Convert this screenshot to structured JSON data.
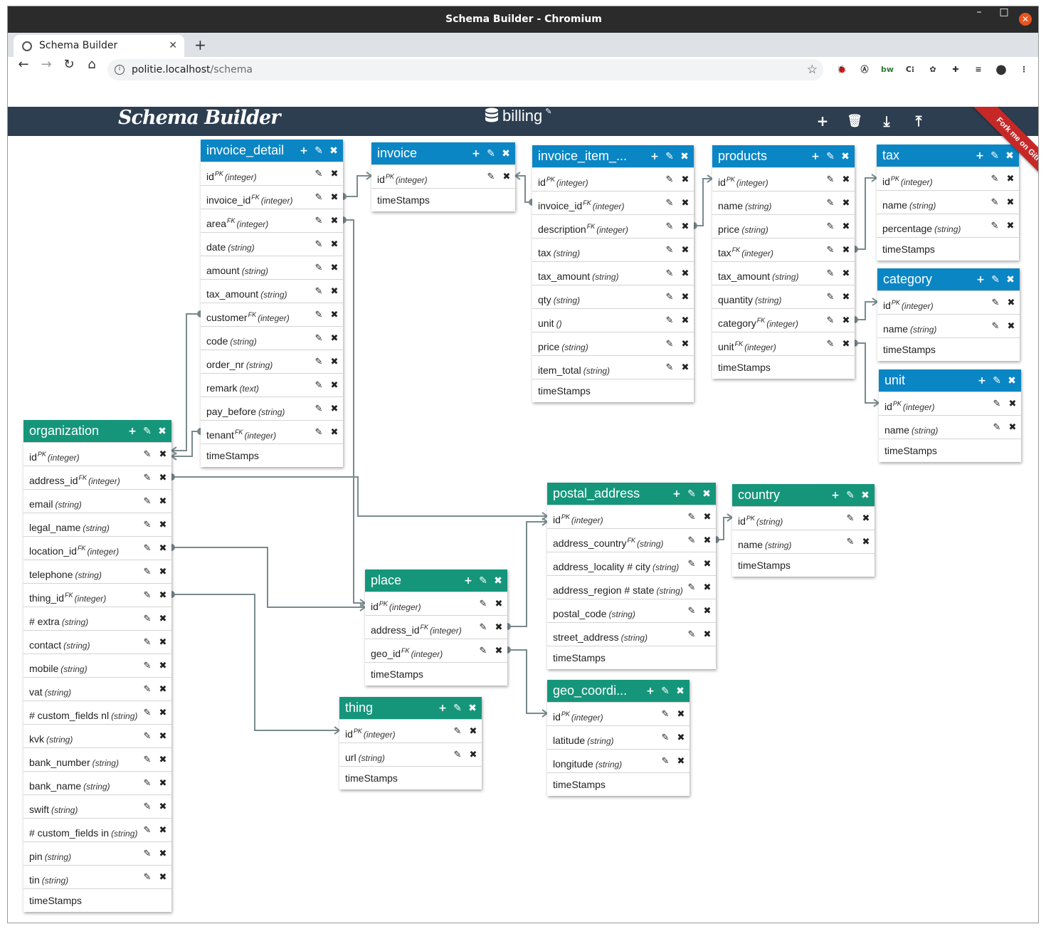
{
  "window": {
    "title": "Schema Builder - Chromium",
    "min": "–",
    "max": "□",
    "close": "✕"
  },
  "tab": {
    "title": "Schema Builder",
    "close": "✕",
    "newtab": "+"
  },
  "nav": {
    "back": "←",
    "forward": "→",
    "reload": "↻",
    "home": "⌂"
  },
  "address": {
    "host": "politie.localhost",
    "path": "/schema",
    "star": "☆"
  },
  "extensions": [
    "🐞",
    "Ⓐ",
    "bw",
    "C⁝",
    "✿",
    "✚",
    "≡",
    "●",
    "⋮"
  ],
  "app": {
    "brand": "Schema Builder",
    "database": "billing",
    "edit_icon": "✎",
    "actions": {
      "add": "+",
      "delete": "🗑",
      "download": "⤓",
      "upload": "⤒"
    },
    "ribbon": "Fork me on GitHub"
  },
  "icons": {
    "add": "+",
    "edit": "✎",
    "remove": "✖"
  },
  "colors": {
    "header": "#2c3e50",
    "blue": "#0b86c5",
    "green": "#15967b",
    "link": "#7a8a8d",
    "ribbon": "#c62828"
  },
  "tables": {
    "invoice_detail": {
      "name": "invoice_detail",
      "columns": [
        {
          "name": "id",
          "key": "PK",
          "type": "(integer)"
        },
        {
          "name": "invoice_id",
          "key": "FK",
          "type": "(integer)"
        },
        {
          "name": "area",
          "key": "FK",
          "type": "(integer)"
        },
        {
          "name": "date",
          "key": "",
          "type": "(string)"
        },
        {
          "name": "amount",
          "key": "",
          "type": "(string)"
        },
        {
          "name": "tax_amount",
          "key": "",
          "type": "(string)"
        },
        {
          "name": "customer",
          "key": "FK",
          "type": "(integer)"
        },
        {
          "name": "code",
          "key": "",
          "type": "(string)"
        },
        {
          "name": "order_nr",
          "key": "",
          "type": "(string)"
        },
        {
          "name": "remark",
          "key": "",
          "type": "(text)"
        },
        {
          "name": "pay_before",
          "key": "",
          "type": "(string)"
        },
        {
          "name": "tenant",
          "key": "FK",
          "type": "(integer)"
        }
      ],
      "footer": "timeStamps"
    },
    "invoice": {
      "name": "invoice",
      "columns": [
        {
          "name": "id",
          "key": "PK",
          "type": "(integer)"
        }
      ],
      "footer": "timeStamps"
    },
    "invoice_item": {
      "name": "invoice_item_...",
      "columns": [
        {
          "name": "id",
          "key": "PK",
          "type": "(integer)"
        },
        {
          "name": "invoice_id",
          "key": "FK",
          "type": "(integer)"
        },
        {
          "name": "description",
          "key": "FK",
          "type": "(integer)"
        },
        {
          "name": "tax",
          "key": "",
          "type": "(string)"
        },
        {
          "name": "tax_amount",
          "key": "",
          "type": "(string)"
        },
        {
          "name": "qty",
          "key": "",
          "type": "(string)"
        },
        {
          "name": "unit",
          "key": "",
          "type": "()"
        },
        {
          "name": "price",
          "key": "",
          "type": "(string)"
        },
        {
          "name": "item_total",
          "key": "",
          "type": "(string)"
        }
      ],
      "footer": "timeStamps"
    },
    "products": {
      "name": "products",
      "columns": [
        {
          "name": "id",
          "key": "PK",
          "type": "(integer)"
        },
        {
          "name": "name",
          "key": "",
          "type": "(string)"
        },
        {
          "name": "price",
          "key": "",
          "type": "(string)"
        },
        {
          "name": "tax",
          "key": "FK",
          "type": "(integer)"
        },
        {
          "name": "tax_amount",
          "key": "",
          "type": "(string)"
        },
        {
          "name": "quantity",
          "key": "",
          "type": "(string)"
        },
        {
          "name": "category",
          "key": "FK",
          "type": "(integer)"
        },
        {
          "name": "unit",
          "key": "FK",
          "type": "(integer)"
        }
      ],
      "footer": "timeStamps"
    },
    "tax": {
      "name": "tax",
      "columns": [
        {
          "name": "id",
          "key": "PK",
          "type": "(integer)"
        },
        {
          "name": "name",
          "key": "",
          "type": "(string)"
        },
        {
          "name": "percentage",
          "key": "",
          "type": "(string)"
        }
      ],
      "footer": "timeStamps"
    },
    "category": {
      "name": "category",
      "columns": [
        {
          "name": "id",
          "key": "PK",
          "type": "(integer)"
        },
        {
          "name": "name",
          "key": "",
          "type": "(string)"
        }
      ],
      "footer": "timeStamps"
    },
    "unit": {
      "name": "unit",
      "columns": [
        {
          "name": "id",
          "key": "PK",
          "type": "(integer)"
        },
        {
          "name": "name",
          "key": "",
          "type": "(string)"
        }
      ],
      "footer": "timeStamps"
    },
    "organization": {
      "name": "organization",
      "columns": [
        {
          "name": "id",
          "key": "PK",
          "type": "(integer)"
        },
        {
          "name": "address_id",
          "key": "FK",
          "type": "(integer)"
        },
        {
          "name": "email",
          "key": "",
          "type": "(string)"
        },
        {
          "name": "legal_name",
          "key": "",
          "type": "(string)"
        },
        {
          "name": "location_id",
          "key": "FK",
          "type": "(integer)"
        },
        {
          "name": "telephone",
          "key": "",
          "type": "(string)"
        },
        {
          "name": "thing_id",
          "key": "FK",
          "type": "(integer)"
        },
        {
          "name": "# extra",
          "key": "",
          "type": "(string)"
        },
        {
          "name": "contact",
          "key": "",
          "type": "(string)"
        },
        {
          "name": "mobile",
          "key": "",
          "type": "(string)"
        },
        {
          "name": "vat",
          "key": "",
          "type": "(string)"
        },
        {
          "name": "# custom_fields nl",
          "key": "",
          "type": "(string)"
        },
        {
          "name": "kvk",
          "key": "",
          "type": "(string)"
        },
        {
          "name": "bank_number",
          "key": "",
          "type": "(string)"
        },
        {
          "name": "bank_name",
          "key": "",
          "type": "(string)"
        },
        {
          "name": "swift",
          "key": "",
          "type": "(string)"
        },
        {
          "name": "# custom_fields in",
          "key": "",
          "type": "(string)"
        },
        {
          "name": "pin",
          "key": "",
          "type": "(string)"
        },
        {
          "name": "tin",
          "key": "",
          "type": "(string)"
        }
      ],
      "footer": "timeStamps"
    },
    "postal_address": {
      "name": "postal_address",
      "columns": [
        {
          "name": "id",
          "key": "PK",
          "type": "(integer)"
        },
        {
          "name": "address_country",
          "key": "FK",
          "type": "(string)"
        },
        {
          "name": "address_locality # city",
          "key": "",
          "type": "(string)"
        },
        {
          "name": "address_region # state",
          "key": "",
          "type": "(string)"
        },
        {
          "name": "postal_code",
          "key": "",
          "type": "(string)"
        },
        {
          "name": "street_address",
          "key": "",
          "type": "(string)"
        }
      ],
      "footer": "timeStamps"
    },
    "country": {
      "name": "country",
      "columns": [
        {
          "name": "id",
          "key": "PK",
          "type": "(string)"
        },
        {
          "name": "name",
          "key": "",
          "type": "(string)"
        }
      ],
      "footer": "timeStamps"
    },
    "place": {
      "name": "place",
      "columns": [
        {
          "name": "id",
          "key": "PK",
          "type": "(integer)"
        },
        {
          "name": "address_id",
          "key": "FK",
          "type": "(integer)"
        },
        {
          "name": "geo_id",
          "key": "FK",
          "type": "(integer)"
        }
      ],
      "footer": "timeStamps"
    },
    "geo": {
      "name": "geo_coordi...",
      "columns": [
        {
          "name": "id",
          "key": "PK",
          "type": "(integer)"
        },
        {
          "name": "latitude",
          "key": "",
          "type": "(string)"
        },
        {
          "name": "longitude",
          "key": "",
          "type": "(string)"
        }
      ],
      "footer": "timeStamps"
    },
    "thing": {
      "name": "thing",
      "columns": [
        {
          "name": "id",
          "key": "PK",
          "type": "(integer)"
        },
        {
          "name": "url",
          "key": "",
          "type": "(string)"
        }
      ],
      "footer": "timeStamps"
    }
  }
}
